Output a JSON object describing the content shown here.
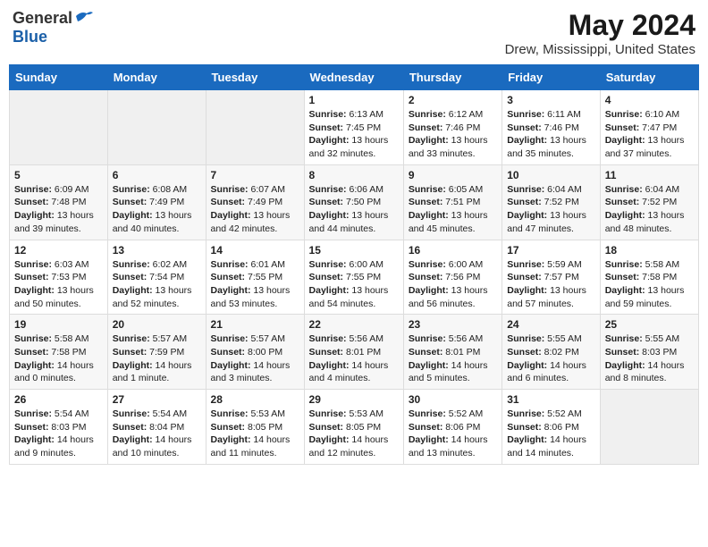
{
  "header": {
    "logo_general": "General",
    "logo_blue": "Blue",
    "title": "May 2024",
    "subtitle": "Drew, Mississippi, United States"
  },
  "weekdays": [
    "Sunday",
    "Monday",
    "Tuesday",
    "Wednesday",
    "Thursday",
    "Friday",
    "Saturday"
  ],
  "weeks": [
    [
      {
        "day": "",
        "content": ""
      },
      {
        "day": "",
        "content": ""
      },
      {
        "day": "",
        "content": ""
      },
      {
        "day": "1",
        "content": "Sunrise: 6:13 AM\nSunset: 7:45 PM\nDaylight: 13 hours\nand 32 minutes."
      },
      {
        "day": "2",
        "content": "Sunrise: 6:12 AM\nSunset: 7:46 PM\nDaylight: 13 hours\nand 33 minutes."
      },
      {
        "day": "3",
        "content": "Sunrise: 6:11 AM\nSunset: 7:46 PM\nDaylight: 13 hours\nand 35 minutes."
      },
      {
        "day": "4",
        "content": "Sunrise: 6:10 AM\nSunset: 7:47 PM\nDaylight: 13 hours\nand 37 minutes."
      }
    ],
    [
      {
        "day": "5",
        "content": "Sunrise: 6:09 AM\nSunset: 7:48 PM\nDaylight: 13 hours\nand 39 minutes."
      },
      {
        "day": "6",
        "content": "Sunrise: 6:08 AM\nSunset: 7:49 PM\nDaylight: 13 hours\nand 40 minutes."
      },
      {
        "day": "7",
        "content": "Sunrise: 6:07 AM\nSunset: 7:49 PM\nDaylight: 13 hours\nand 42 minutes."
      },
      {
        "day": "8",
        "content": "Sunrise: 6:06 AM\nSunset: 7:50 PM\nDaylight: 13 hours\nand 44 minutes."
      },
      {
        "day": "9",
        "content": "Sunrise: 6:05 AM\nSunset: 7:51 PM\nDaylight: 13 hours\nand 45 minutes."
      },
      {
        "day": "10",
        "content": "Sunrise: 6:04 AM\nSunset: 7:52 PM\nDaylight: 13 hours\nand 47 minutes."
      },
      {
        "day": "11",
        "content": "Sunrise: 6:04 AM\nSunset: 7:52 PM\nDaylight: 13 hours\nand 48 minutes."
      }
    ],
    [
      {
        "day": "12",
        "content": "Sunrise: 6:03 AM\nSunset: 7:53 PM\nDaylight: 13 hours\nand 50 minutes."
      },
      {
        "day": "13",
        "content": "Sunrise: 6:02 AM\nSunset: 7:54 PM\nDaylight: 13 hours\nand 52 minutes."
      },
      {
        "day": "14",
        "content": "Sunrise: 6:01 AM\nSunset: 7:55 PM\nDaylight: 13 hours\nand 53 minutes."
      },
      {
        "day": "15",
        "content": "Sunrise: 6:00 AM\nSunset: 7:55 PM\nDaylight: 13 hours\nand 54 minutes."
      },
      {
        "day": "16",
        "content": "Sunrise: 6:00 AM\nSunset: 7:56 PM\nDaylight: 13 hours\nand 56 minutes."
      },
      {
        "day": "17",
        "content": "Sunrise: 5:59 AM\nSunset: 7:57 PM\nDaylight: 13 hours\nand 57 minutes."
      },
      {
        "day": "18",
        "content": "Sunrise: 5:58 AM\nSunset: 7:58 PM\nDaylight: 13 hours\nand 59 minutes."
      }
    ],
    [
      {
        "day": "19",
        "content": "Sunrise: 5:58 AM\nSunset: 7:58 PM\nDaylight: 14 hours\nand 0 minutes."
      },
      {
        "day": "20",
        "content": "Sunrise: 5:57 AM\nSunset: 7:59 PM\nDaylight: 14 hours\nand 1 minute."
      },
      {
        "day": "21",
        "content": "Sunrise: 5:57 AM\nSunset: 8:00 PM\nDaylight: 14 hours\nand 3 minutes."
      },
      {
        "day": "22",
        "content": "Sunrise: 5:56 AM\nSunset: 8:01 PM\nDaylight: 14 hours\nand 4 minutes."
      },
      {
        "day": "23",
        "content": "Sunrise: 5:56 AM\nSunset: 8:01 PM\nDaylight: 14 hours\nand 5 minutes."
      },
      {
        "day": "24",
        "content": "Sunrise: 5:55 AM\nSunset: 8:02 PM\nDaylight: 14 hours\nand 6 minutes."
      },
      {
        "day": "25",
        "content": "Sunrise: 5:55 AM\nSunset: 8:03 PM\nDaylight: 14 hours\nand 8 minutes."
      }
    ],
    [
      {
        "day": "26",
        "content": "Sunrise: 5:54 AM\nSunset: 8:03 PM\nDaylight: 14 hours\nand 9 minutes."
      },
      {
        "day": "27",
        "content": "Sunrise: 5:54 AM\nSunset: 8:04 PM\nDaylight: 14 hours\nand 10 minutes."
      },
      {
        "day": "28",
        "content": "Sunrise: 5:53 AM\nSunset: 8:05 PM\nDaylight: 14 hours\nand 11 minutes."
      },
      {
        "day": "29",
        "content": "Sunrise: 5:53 AM\nSunset: 8:05 PM\nDaylight: 14 hours\nand 12 minutes."
      },
      {
        "day": "30",
        "content": "Sunrise: 5:52 AM\nSunset: 8:06 PM\nDaylight: 14 hours\nand 13 minutes."
      },
      {
        "day": "31",
        "content": "Sunrise: 5:52 AM\nSunset: 8:06 PM\nDaylight: 14 hours\nand 14 minutes."
      },
      {
        "day": "",
        "content": ""
      }
    ]
  ]
}
